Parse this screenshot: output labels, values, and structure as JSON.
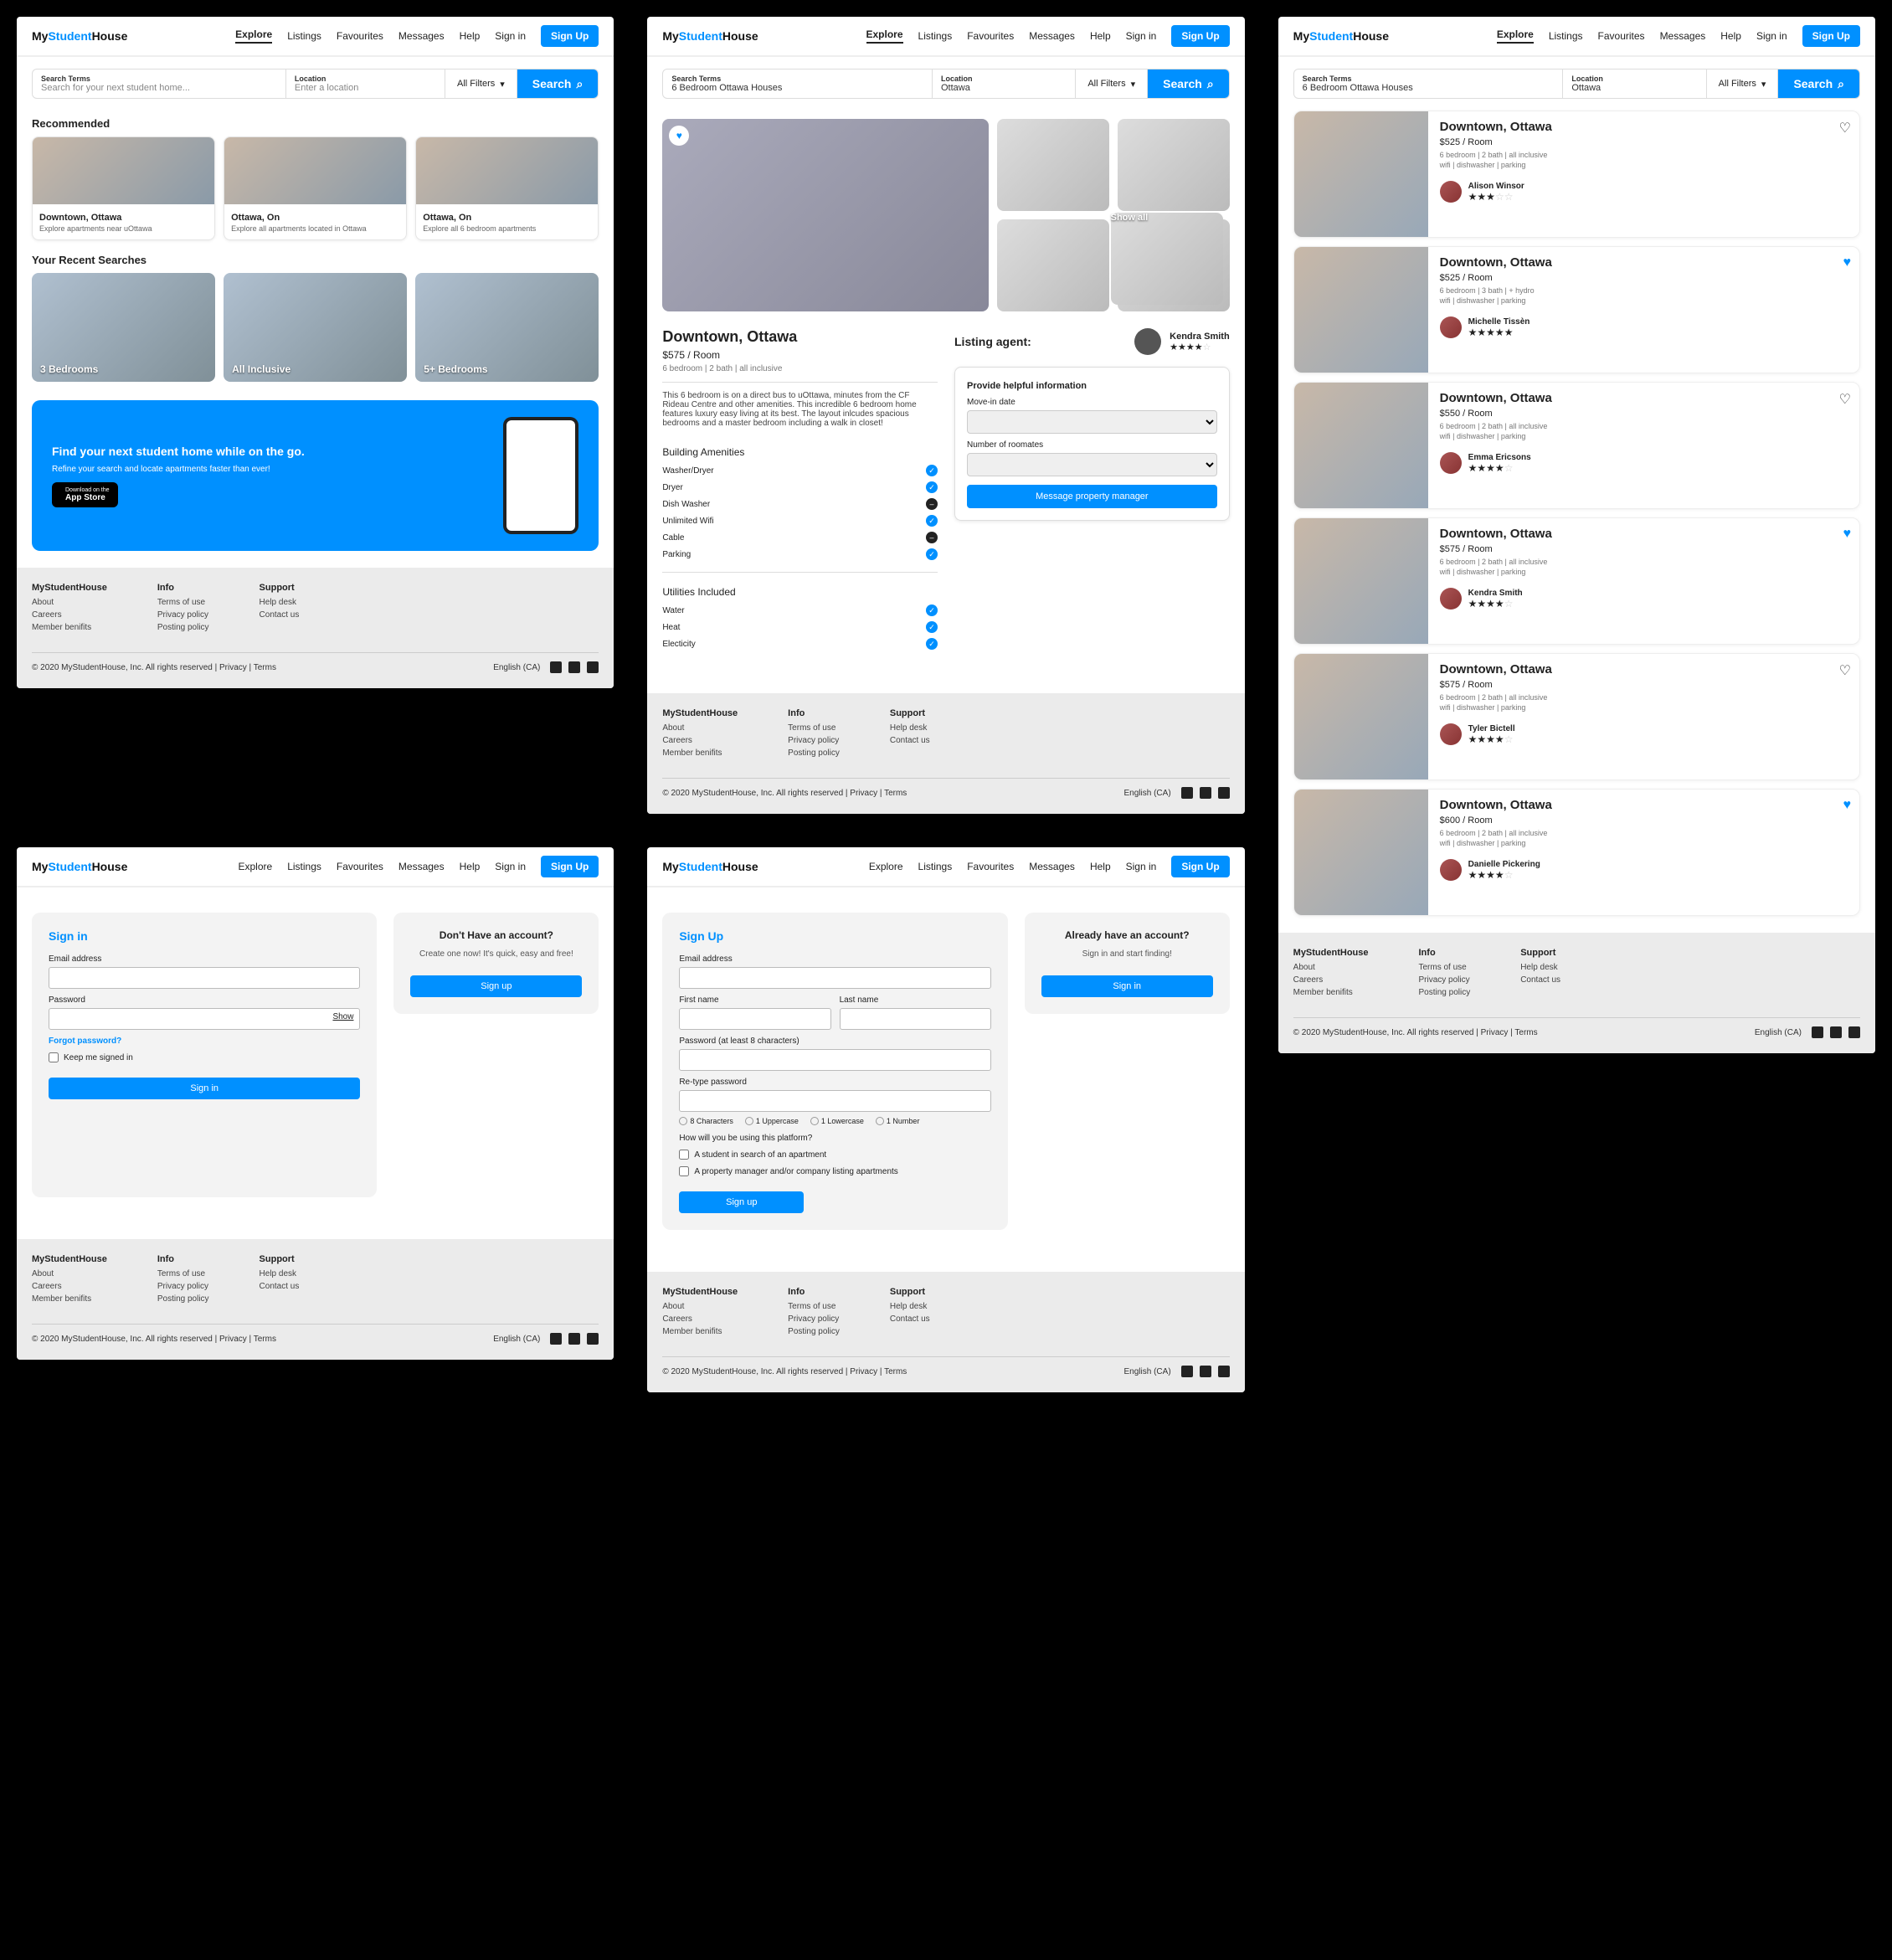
{
  "brand": {
    "my": "My",
    "st": "Student",
    "hs": "House"
  },
  "nav": {
    "explore": "Explore",
    "listings": "Listings",
    "favourites": "Favourites",
    "messages": "Messages",
    "help": "Help",
    "signin": "Sign in",
    "signup": "Sign Up"
  },
  "search": {
    "terms_label": "Search Terms",
    "terms_ph": "Search for your next student home...",
    "terms_val": "6 Bedroom Ottawa Houses",
    "loc_label": "Location",
    "loc_ph": "Enter a location",
    "loc_val": "Ottawa",
    "filters": "All Filters",
    "go": "Search"
  },
  "home": {
    "recommended_title": "Recommended",
    "recommended": [
      {
        "title": "Downtown, Ottawa",
        "sub": "Explore apartments near uOttawa"
      },
      {
        "title": "Ottawa, On",
        "sub": "Explore all apartments located in Ottawa"
      },
      {
        "title": "Ottawa, On",
        "sub": "Explore all 6 bedroom apartments"
      }
    ],
    "recent_title": "Your Recent Searches",
    "recent": [
      "3 Bedrooms",
      "All Inclusive",
      "5+ Bedrooms"
    ],
    "banner": {
      "title": "Find your next student home while on the go.",
      "body": "Refine your search and locate apartments faster than ever!",
      "appstore": "App Store",
      "appstore_pre": "Download on the"
    }
  },
  "footer": {
    "c1": "MyStudentHouse",
    "c1_links": [
      "About",
      "Careers",
      "Member benifits"
    ],
    "c2": "Info",
    "c2_links": [
      "Terms of use",
      "Privacy policy",
      "Posting policy"
    ],
    "c3": "Support",
    "c3_links": [
      "Help desk",
      "Contact us"
    ],
    "copy": "© 2020 MyStudentHouse, Inc. All rights reserved | ",
    "privacy": "Privacy",
    "terms": "Terms",
    "lang": "English (CA)"
  },
  "detail": {
    "title": "Downtown, Ottawa",
    "price": "$575 / Room",
    "meta": "6 bedroom | 2 bath | all inclusive",
    "desc": "This 6 bedroom is on a direct bus to uOttawa, minutes from the CF Rideau Centre and other amenities. This incredible 6 bedroom home features luxury easy living at its best. The layout inlcudes spacious bedrooms and a master bedroom including a walk in closet!",
    "showall": "Show all",
    "amen_title": "Building Amenities",
    "amenities": [
      {
        "name": "Washer/Dryer",
        "ok": true
      },
      {
        "name": "Dryer",
        "ok": true
      },
      {
        "name": "Dish Washer",
        "ok": false
      },
      {
        "name": "Unlimited Wifi",
        "ok": true
      },
      {
        "name": "Cable",
        "ok": false
      },
      {
        "name": "Parking",
        "ok": true
      }
    ],
    "util_title": "Utilities Included",
    "utilities": [
      {
        "name": "Water",
        "ok": true
      },
      {
        "name": "Heat",
        "ok": true
      },
      {
        "name": "Electicity",
        "ok": true
      }
    ],
    "agent_label": "Listing agent:",
    "agent_name": "Kendra Smith",
    "info_title": "Provide helpful information",
    "movein": "Move-in date",
    "roommates": "Number of roomates",
    "msg": "Message property manager"
  },
  "signin": {
    "title": "Sign in",
    "email": "Email address",
    "password": "Password",
    "show": "Show",
    "forgot": "Forgot password?",
    "keep": "Keep me signed in",
    "btn": "Sign in",
    "side_title": "Don't Have an account?",
    "side_body": "Create one now! It's quick, easy and free!",
    "side_btn": "Sign up"
  },
  "signup": {
    "title": "Sign Up",
    "email": "Email address",
    "first": "First name",
    "last": "Last name",
    "password": "Password (at least 8 characters)",
    "retype": "Re-type password",
    "req": [
      "8 Characters",
      "1 Uppercase",
      "1 Lowercase",
      "1 Number"
    ],
    "how": "How will you be using this platform?",
    "opt1": "A student in search of an apartment",
    "opt2": "A property manager and/or company listing apartments",
    "btn": "Sign up",
    "side_title": "Already have an account?",
    "side_body": "Sign in and start finding!",
    "side_btn": "Sign in"
  },
  "results": {
    "items": [
      {
        "title": "Downtown, Ottawa",
        "price": "$525 / Room",
        "l1": "6 bedroom | 2 bath | all inclusive",
        "l2": "wifi | dishwasher | parking",
        "agent": "Alison Winsor",
        "stars": 3,
        "fav": false
      },
      {
        "title": "Downtown, Ottawa",
        "price": "$525 / Room",
        "l1": "6 bedroom | 3 bath | + hydro",
        "l2": "wifi | dishwasher | parking",
        "agent": "Michelle Tissèn",
        "stars": 5,
        "fav": true
      },
      {
        "title": "Downtown, Ottawa",
        "price": "$550 / Room",
        "l1": "6 bedroom | 2 bath | all inclusive",
        "l2": "wifi | dishwasher | parking",
        "agent": "Emma Ericsons",
        "stars": 4,
        "fav": false
      },
      {
        "title": "Downtown, Ottawa",
        "price": "$575 / Room",
        "l1": "6 bedroom | 2 bath | all inclusive",
        "l2": "wifi | dishwasher | parking",
        "agent": "Kendra Smith",
        "stars": 4,
        "fav": true
      },
      {
        "title": "Downtown, Ottawa",
        "price": "$575 / Room",
        "l1": "6 bedroom | 2 bath | all inclusive",
        "l2": "wifi | dishwasher | parking",
        "agent": "Tyler Bictell",
        "stars": 4,
        "fav": false
      },
      {
        "title": "Downtown, Ottawa",
        "price": "$600 / Room",
        "l1": "6 bedroom | 2 bath | all inclusive",
        "l2": "wifi | dishwasher | parking",
        "agent": "Danielle Pickering",
        "stars": 4,
        "fav": true
      }
    ]
  }
}
